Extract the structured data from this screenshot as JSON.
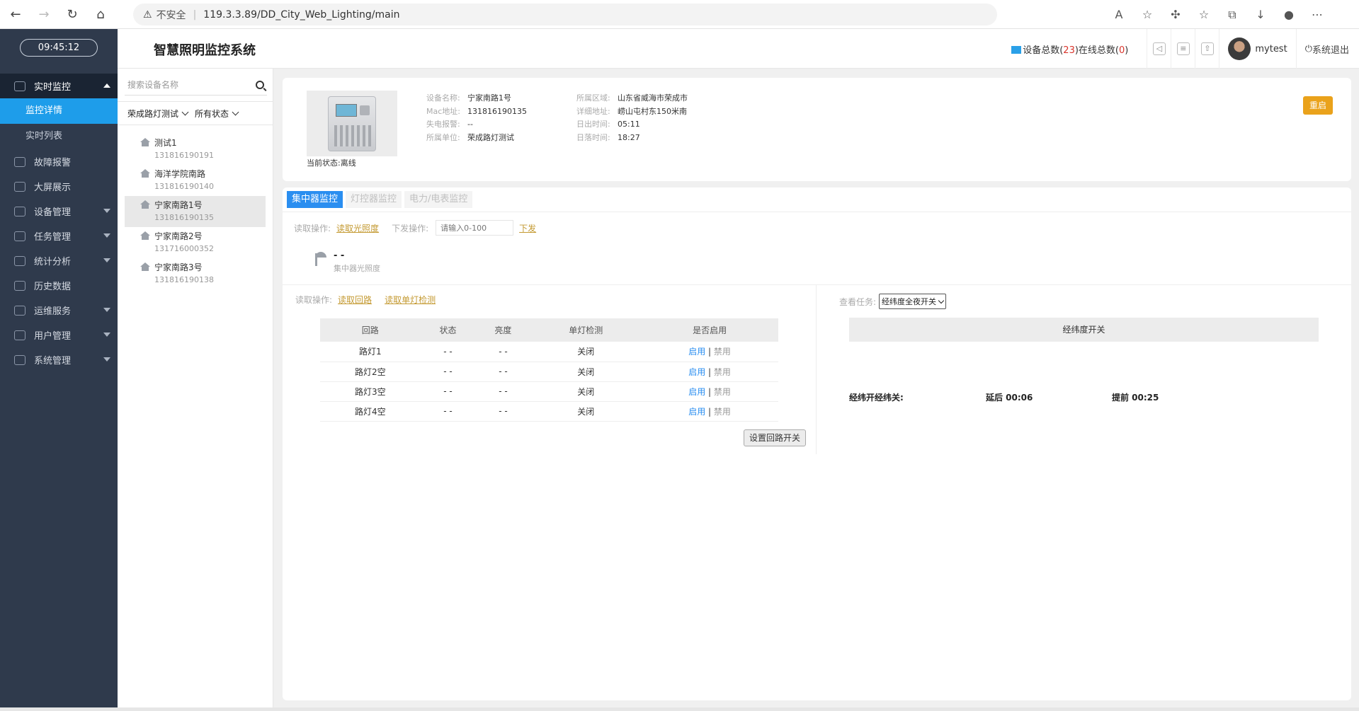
{
  "browser": {
    "security": "不安全",
    "url": "119.3.3.89/DD_City_Web_Lighting/main"
  },
  "sidebar": {
    "clock": "09:45:12",
    "items": [
      {
        "label": "实时监控",
        "icon": "monitor-icon"
      },
      {
        "label": "故障报警",
        "icon": "alert-icon"
      },
      {
        "label": "大屏展示",
        "icon": "screen-icon"
      },
      {
        "label": "设备管理",
        "icon": "device-icon"
      },
      {
        "label": "任务管理",
        "icon": "task-icon"
      },
      {
        "label": "统计分析",
        "icon": "stats-icon"
      },
      {
        "label": "历史数据",
        "icon": "history-icon"
      },
      {
        "label": "运维服务",
        "icon": "service-icon"
      },
      {
        "label": "用户管理",
        "icon": "user-icon"
      },
      {
        "label": "系统管理",
        "icon": "gear-icon"
      }
    ],
    "sub": [
      "监控详情",
      "实时列表"
    ]
  },
  "header": {
    "title": "智慧照明监控系统",
    "dev_total_label": "设备总数(",
    "dev_total": "23",
    "online_label": ")在线总数(",
    "online": "0",
    "close_paren": ")",
    "username": "mytest",
    "logout": "系统退出"
  },
  "devpanel": {
    "search_placeholder": "搜索设备名称",
    "filter_group": "荣成路灯测试",
    "filter_status": "所有状态",
    "devices": [
      {
        "name": "测试1",
        "mac": "131816190191"
      },
      {
        "name": "海洋学院南路",
        "mac": "131816190140"
      },
      {
        "name": "宁家南路1号",
        "mac": "131816190135"
      },
      {
        "name": "宁家南路2号",
        "mac": "131716000352"
      },
      {
        "name": "宁家南路3号",
        "mac": "131816190138"
      }
    ]
  },
  "device": {
    "status": "当前状态:离线",
    "col1": [
      {
        "k": "设备名称:",
        "v": "宁家南路1号"
      },
      {
        "k": "Mac地址:",
        "v": "131816190135"
      },
      {
        "k": "失电报警:",
        "v": "--"
      },
      {
        "k": "所属单位:",
        "v": "荣成路灯测试"
      }
    ],
    "col2": [
      {
        "k": "所属区域:",
        "v": "山东省威海市荣成市"
      },
      {
        "k": "详细地址:",
        "v": "崂山屯村东150米南"
      },
      {
        "k": "日出时间:",
        "v": "05:11"
      },
      {
        "k": "日落时间:",
        "v": "18:27"
      }
    ],
    "restart": "重启"
  },
  "tabs": [
    "集中器监控",
    "灯控器监控",
    "电力/电表监控"
  ],
  "ops": {
    "read_label": "读取操作:",
    "read_lux": "读取光照度",
    "send_label": "下发操作:",
    "send_placeholder": "请输入0-100",
    "send": "下发",
    "lux_value": "- -",
    "lux_label": "集中器光照度",
    "read_loop": "读取回路",
    "read_single": "读取单灯检测"
  },
  "loop_table": {
    "headers": [
      "回路",
      "状态",
      "亮度",
      "单灯检测",
      "是否启用"
    ],
    "rows": [
      {
        "name": "路灯1",
        "state": "- -",
        "bright": "- -",
        "detect": "关闭"
      },
      {
        "name": "路灯2空",
        "state": "- -",
        "bright": "- -",
        "detect": "关闭"
      },
      {
        "name": "路灯3空",
        "state": "- -",
        "bright": "- -",
        "detect": "关闭"
      },
      {
        "name": "路灯4空",
        "state": "- -",
        "bright": "- -",
        "detect": "关闭"
      }
    ],
    "enable": "启用",
    "pipe": "|",
    "disable": "禁用",
    "set_button": "设置回路开关"
  },
  "task": {
    "label": "查看任务:",
    "selected": "经纬度全夜开关",
    "header": "经纬度开关",
    "row_label": "经纬开经纬关:",
    "delay": "延后 00:06",
    "advance": "提前 00:25"
  }
}
